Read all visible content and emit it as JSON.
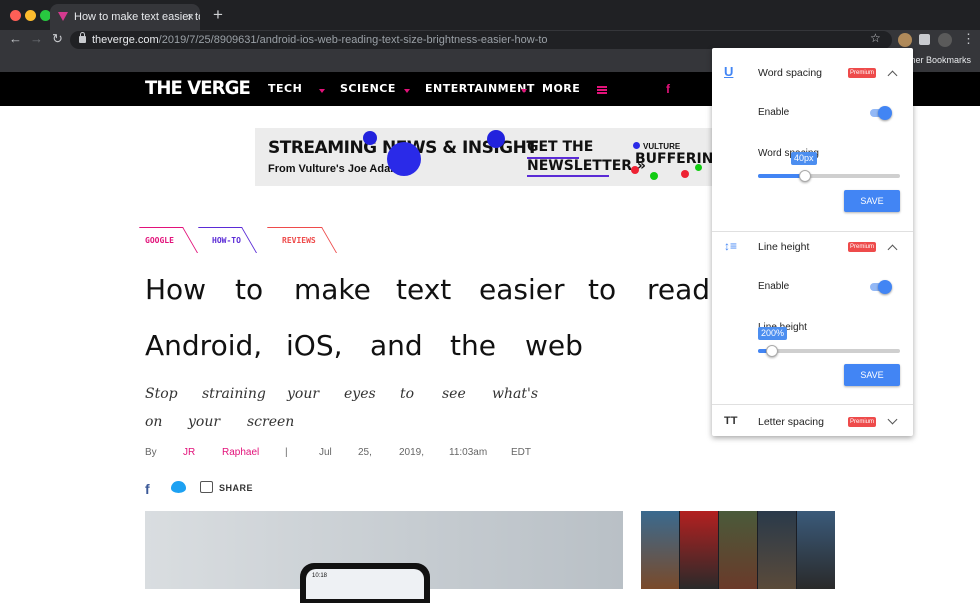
{
  "browser": {
    "tab_title": "How to make text easier to rea",
    "tab_close": "×",
    "new_tab": "+",
    "back": "←",
    "forward": "→",
    "reload": "↻",
    "url_host": "theverge.com",
    "url_path": "/2019/7/25/8909631/android-ios-web-reading-text-size-brightness-easier-how-to",
    "star": "☆",
    "menu": "⋮",
    "bookmarks_other": "ther Bookmarks",
    "colors": {
      "frame": "#202124",
      "toolbar": "#35363a",
      "accent": "#4285f4"
    }
  },
  "site": {
    "logo": "THE VERGE",
    "nav": [
      "TECH",
      "SCIENCE",
      "ENTERTAINMENT",
      "MORE"
    ],
    "social_fb": "f",
    "accent": "#e2127a"
  },
  "ad": {
    "headline": "STREAMING NEWS & INSIGHT",
    "byline": "From Vulture's Joe Adalian",
    "cta_line1": "GET THE",
    "cta_line2": "NEWSLETTER »",
    "brand_small": "VULTURE",
    "brand_big": "BUFFERING"
  },
  "article": {
    "tags": [
      "GOOGLE",
      "HOW-TO",
      "REVIEWS"
    ],
    "title_line1": [
      "How",
      "to",
      "make",
      "text",
      "easier",
      "to",
      "read"
    ],
    "title_line2": [
      "Android,",
      "iOS,",
      "and",
      "the",
      "web"
    ],
    "subtitle_line1": [
      "Stop",
      "straining",
      "your",
      "eyes",
      "to",
      "see",
      "what's"
    ],
    "subtitle_line2": [
      "on",
      "your",
      "screen"
    ],
    "by": "By",
    "author_first": "JR",
    "author_last": "Raphael",
    "pipe": "|",
    "date": [
      "Jul",
      "25,",
      "2019,",
      "11:03am",
      "EDT"
    ],
    "share_label": "SHARE",
    "phone_time": "10:18"
  },
  "panel": {
    "sections": [
      {
        "title": "Word spacing",
        "badge": "Premium",
        "expanded": true,
        "icon": "underline-icon",
        "enable_label": "Enable",
        "enabled": true,
        "slider_label": "Word spacing",
        "slider_value": "40px",
        "slider_fraction": 0.33,
        "save_label": "SAVE"
      },
      {
        "title": "Line height",
        "badge": "Premium",
        "expanded": true,
        "icon": "line-height-icon",
        "enable_label": "Enable",
        "enabled": true,
        "slider_label": "Line height",
        "slider_value": "200%",
        "slider_fraction": 0.1,
        "save_label": "SAVE"
      },
      {
        "title": "Letter spacing",
        "badge": "Premium",
        "expanded": false,
        "icon": "letter-spacing-icon"
      }
    ]
  }
}
